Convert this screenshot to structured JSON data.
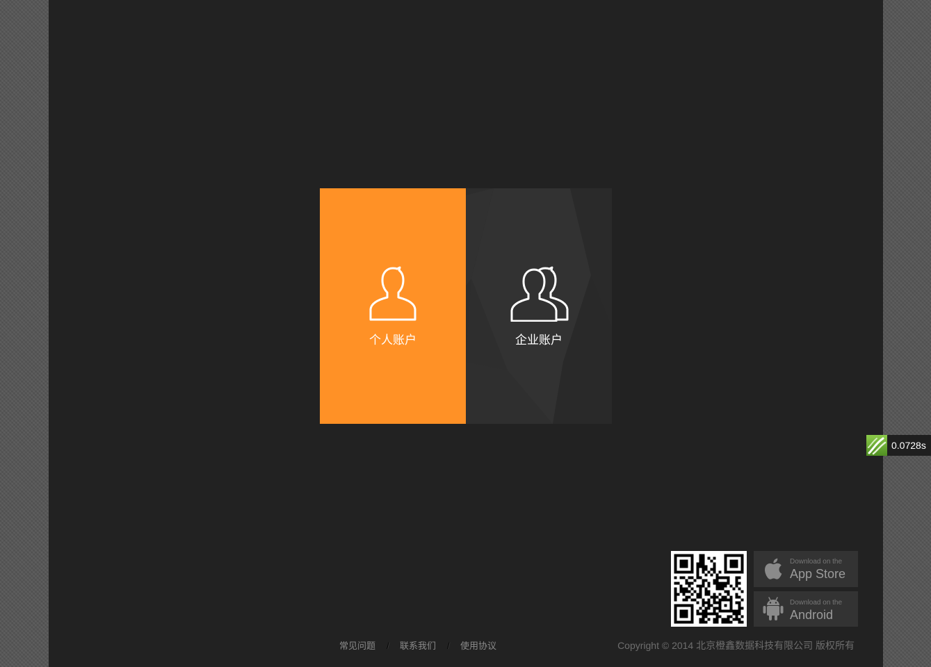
{
  "accounts": [
    {
      "label": "个人账户",
      "icon": "person-icon"
    },
    {
      "label": "企业账户",
      "icon": "group-icon"
    }
  ],
  "timer": {
    "value": "0.0728s",
    "icon": "profiler-icon"
  },
  "download": {
    "qr_icon": "qr-code-icon",
    "app_store": {
      "line1": "Download on the",
      "line2": "App Store",
      "icon": "apple-icon"
    },
    "android": {
      "line1": "Download on the",
      "line2": "Android",
      "icon": "android-icon"
    }
  },
  "footer": {
    "links": [
      "常见问题",
      "联系我们",
      "使用协议"
    ],
    "separator": "/",
    "copyright": "Copyright © 2014 北京橙鑫数据科技有限公司 版权所有"
  },
  "colors": {
    "personal_tile": "#ff9126",
    "enterprise_tile": "#2d2d2d",
    "panel": "#222222",
    "profiler_green": "#6db33f"
  }
}
